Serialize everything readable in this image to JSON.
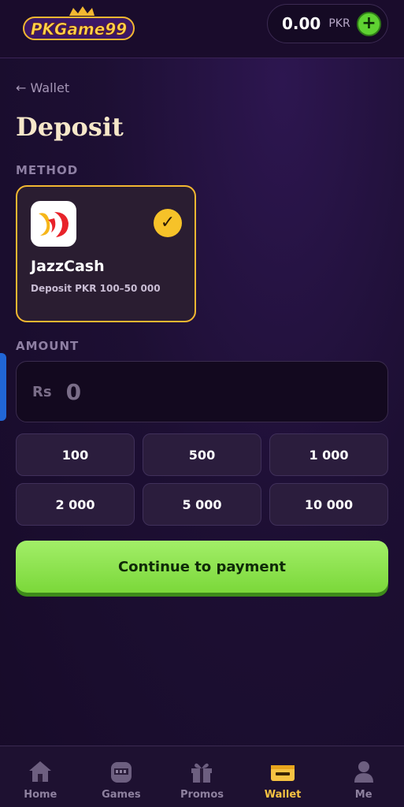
{
  "header": {
    "logo_text": "PKGame99",
    "balance": "0.00",
    "currency": "PKR",
    "add_label": "+"
  },
  "page": {
    "back_label": "← Wallet",
    "title": "Deposit"
  },
  "method_section": {
    "label": "METHOD",
    "selected": {
      "name": "JazzCash",
      "range": "Deposit PKR 100–50 000",
      "check": "✓"
    }
  },
  "amount_section": {
    "label": "AMOUNT",
    "prefix": "Rs",
    "value": "0",
    "presets": [
      "100",
      "500",
      "1 000",
      "2 000",
      "5 000",
      "10 000"
    ]
  },
  "continue_label": "Continue to payment",
  "nav": {
    "items": [
      {
        "label": "Home",
        "icon": "home-icon",
        "active": false
      },
      {
        "label": "Games",
        "icon": "slot-machine-icon",
        "active": false
      },
      {
        "label": "Promos",
        "icon": "gift-icon",
        "active": false
      },
      {
        "label": "Wallet",
        "icon": "wallet-icon",
        "active": true
      },
      {
        "label": "Me",
        "icon": "person-icon",
        "active": false
      }
    ]
  },
  "colors": {
    "accent_gold": "#f2b731",
    "accent_green": "#7bd83a",
    "background": "#1d0f33"
  }
}
